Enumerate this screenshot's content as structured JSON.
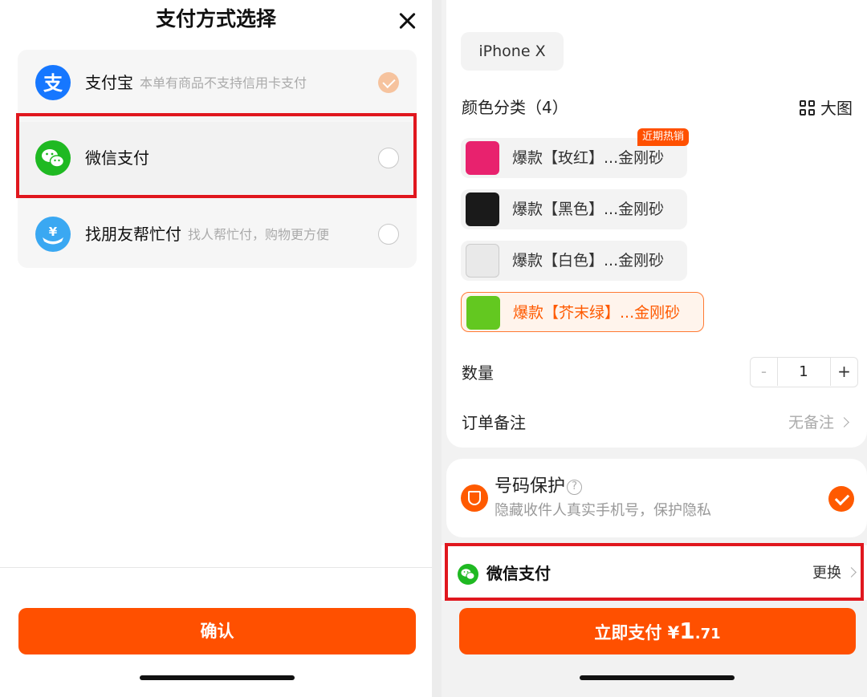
{
  "left_sheet": {
    "title": "支付方式选择",
    "methods": [
      {
        "name": "支付宝",
        "note": "本单有商品不支持信用卡支付",
        "state": "disabled-checked",
        "icon": "alipay-icon"
      },
      {
        "name": "微信支付",
        "note": "",
        "state": "unchecked",
        "icon": "wechat-pay-icon"
      },
      {
        "name": "找朋友帮忙付",
        "note": "找人帮忙付，购物更方便",
        "state": "unchecked",
        "icon": "friend-pay-icon"
      }
    ],
    "confirm_label": "确认"
  },
  "right_sheet": {
    "model": "iPhone X",
    "color_section": {
      "label": "颜色分类（4）",
      "bigview_label": "大图",
      "hot_badge": "近期热销"
    },
    "colors": [
      {
        "label": "爆款【玫红】...金刚砂",
        "swatch": "#e8226e",
        "selected": false
      },
      {
        "label": "爆款【黑色】...金刚砂",
        "swatch": "#1a1a1a",
        "selected": false
      },
      {
        "label": "爆款【白色】...金刚砂",
        "swatch": "#e9e9e9",
        "selected": false
      },
      {
        "label": "爆款【芥末绿】...金刚砂",
        "swatch": "#63c820",
        "selected": true
      }
    ],
    "quantity": {
      "label": "数量",
      "minus": "-",
      "value": "1",
      "plus": "+"
    },
    "remark": {
      "label": "订单备注",
      "value": "无备注"
    },
    "protection": {
      "title": "号码保护",
      "help": "?",
      "subtitle": "隐藏收件人真实手机号，保护隐私",
      "checked": true
    },
    "payment": {
      "method": "微信支付",
      "change_label": "更换"
    },
    "pay_button": {
      "prefix": "立即支付 ¥",
      "amount_int": "1",
      "amount_dec": ".71"
    }
  },
  "colors": {
    "accent": "#ff5000",
    "wechat_green": "#1fb922",
    "alipay_blue": "#1677ff",
    "highlight_red": "#e0171e"
  }
}
